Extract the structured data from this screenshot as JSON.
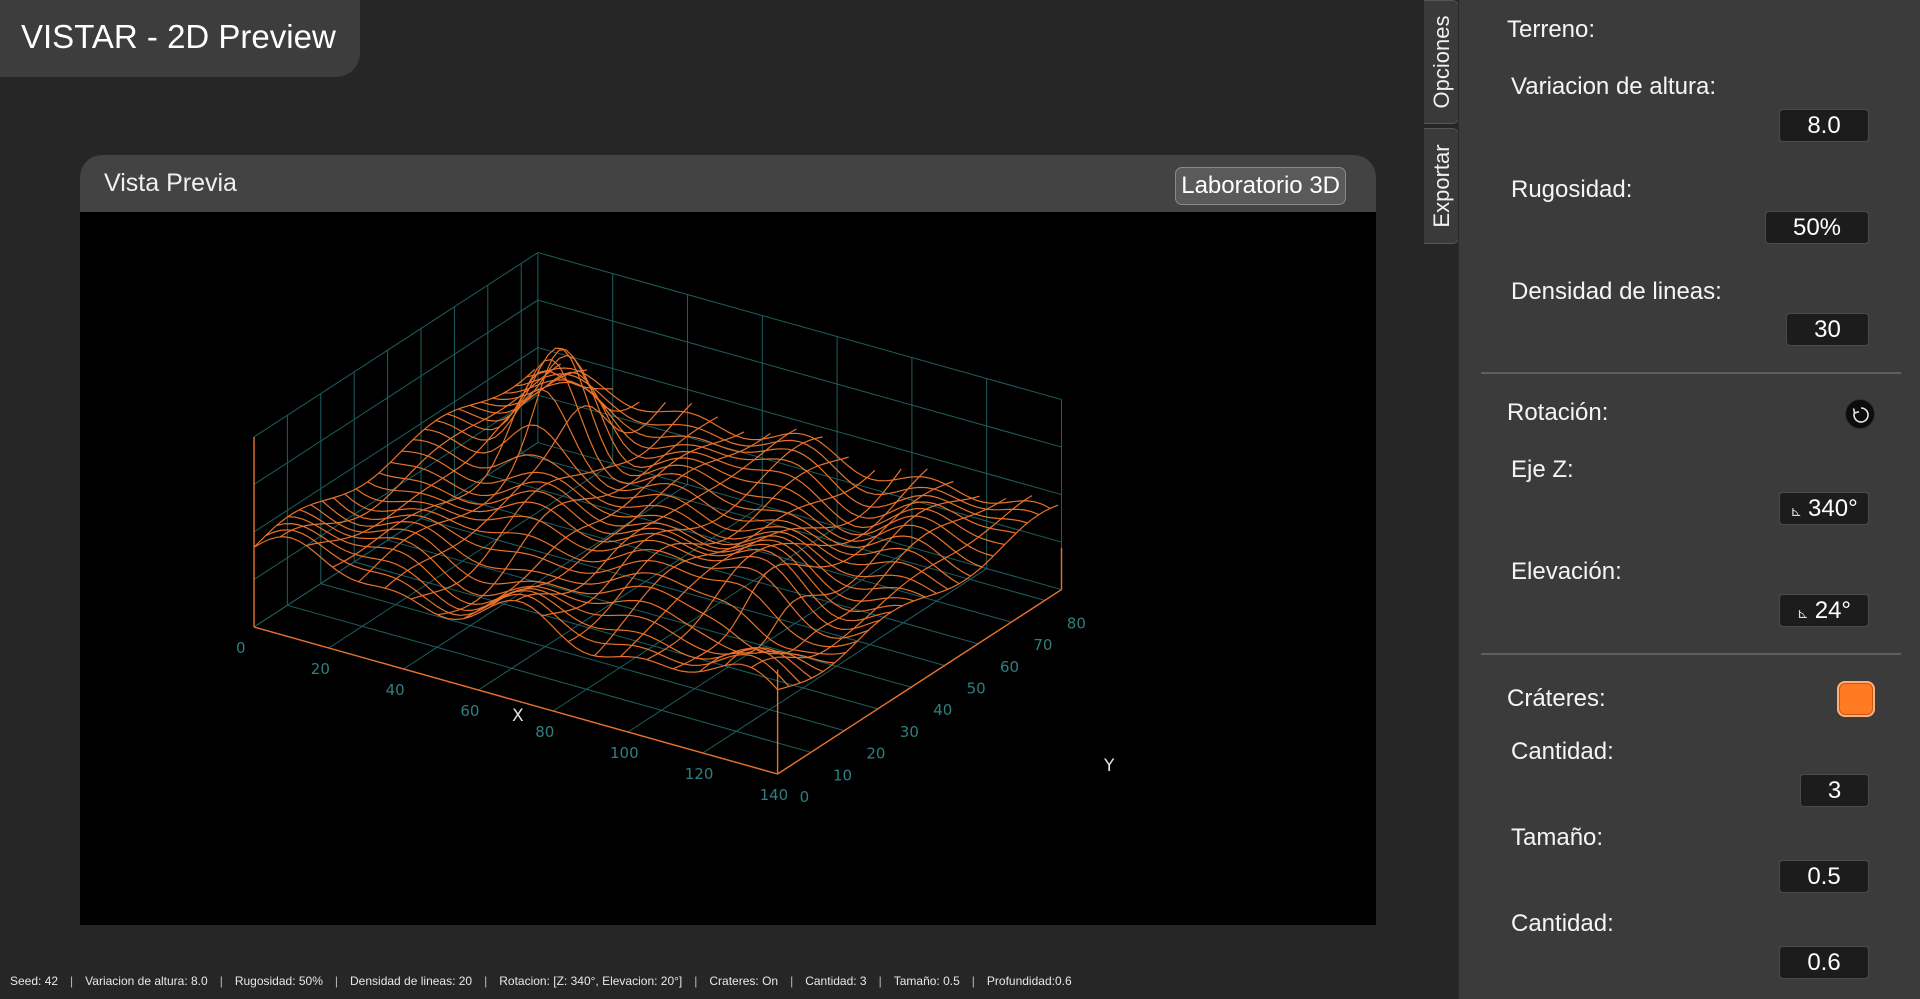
{
  "app": {
    "title": "VISTAR - 2D Preview"
  },
  "preview": {
    "title": "Vista Previa",
    "lab_button": "Laboratorio 3D",
    "plot": {
      "x_label": "X",
      "y_label": "Y",
      "x_ticks": [
        "0",
        "20",
        "40",
        "60",
        "80",
        "100",
        "120",
        "140"
      ],
      "y_ticks": [
        "0",
        "10",
        "20",
        "30",
        "40",
        "50",
        "60",
        "70",
        "80"
      ],
      "line_color": "#e8722a",
      "grid_color": "#1f5f60",
      "tick_color": "#2f7f80"
    }
  },
  "side_tabs": {
    "options": "Opciones",
    "export": "Exportar"
  },
  "panel": {
    "terrain": {
      "title": "Terreno:",
      "height_var_label": "Variacion de altura:",
      "height_var_value": "8.0",
      "roughness_label": "Rugosidad:",
      "roughness_value": "50%",
      "line_density_label": "Densidad de lineas:",
      "line_density_value": "30"
    },
    "rotation": {
      "title": "Rotación:",
      "z_axis_label": "Eje Z:",
      "z_axis_value": "340°",
      "elevation_label": "Elevación:",
      "elevation_value": "24°",
      "angle_icon": "⊾"
    },
    "craters": {
      "title": "Cráteres:",
      "enabled": true,
      "count_label": "Cantidad:",
      "count_value": "3",
      "size_label": "Tamaño:",
      "size_value": "0.5",
      "depth_label": "Cantidad:",
      "depth_value": "0.6"
    }
  },
  "status_bar": [
    "Seed: 42",
    "Variacion de altura: 8.0",
    "Rugosidad: 50%",
    "Densidad de lineas: 20",
    "Rotacion: [Z: 340°, Elevacion: 20°]",
    "Crateres:  On",
    "Cantidad: 3",
    "Tamaño: 0.5",
    "Profundidad:0.6"
  ]
}
